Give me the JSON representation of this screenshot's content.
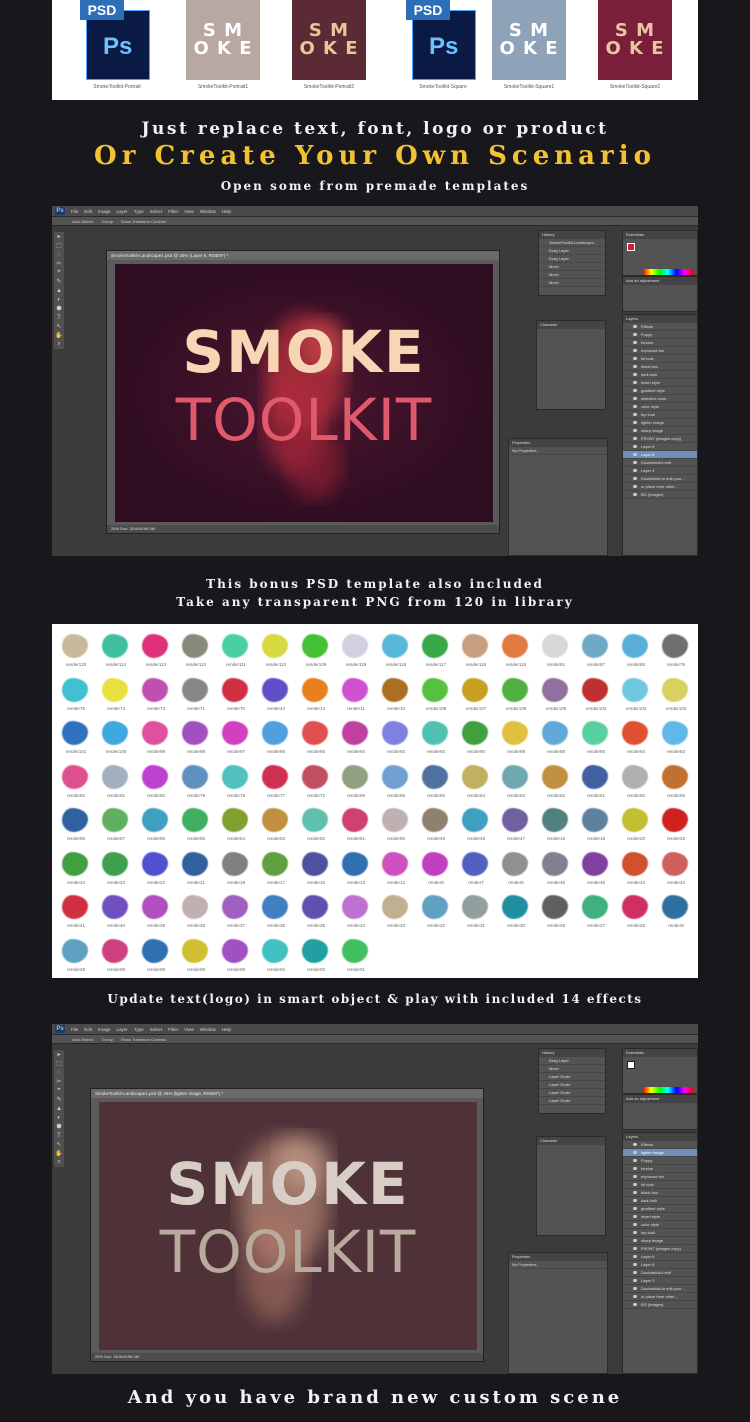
{
  "files": [
    {
      "kind": "psd",
      "ext": "PSD",
      "app": "Ps",
      "caption": "SmokeToolkit-Portrait"
    },
    {
      "kind": "poster",
      "text": "S M O K E",
      "caption": "SmokeToolkit-Portrait1",
      "bg": "#b8a8a4",
      "fg": "#ffffff"
    },
    {
      "kind": "poster",
      "text": "S M O K E",
      "caption": "SmokeToolkit-Portrait2",
      "bg": "#5b2a34",
      "fg": "#e6c79a"
    },
    {
      "kind": "psd",
      "ext": "PSD",
      "app": "Ps",
      "caption": "SmokeToolkit-Square"
    },
    {
      "kind": "poster",
      "text": "S M O K E",
      "caption": "SmokeToolkit-Square1",
      "bg": "#8fa3b8",
      "fg": "#ffffff"
    },
    {
      "kind": "poster",
      "text": "S M O K E",
      "caption": "SmokeToolkit-Square2",
      "bg": "#7a1f3a",
      "fg": "#e8c6a4"
    }
  ],
  "headings": {
    "replace": "Just replace text, font, logo or product",
    "create": "Or Create Your Own Scenario",
    "open": "Open some from premade templates",
    "bonus": "This bonus PSD template also included",
    "take": "Take any transparent PNG from 120 in library",
    "update": "Update text(logo) in smart object & play with included 14 effects",
    "final": "And you have brand new custom scene"
  },
  "ps1": {
    "menu": [
      "File",
      "Edit",
      "Image",
      "Layer",
      "Type",
      "Select",
      "Filter",
      "View",
      "Window",
      "Help"
    ],
    "options": [
      "Auto-Select:",
      "Group",
      "Show Transform Controls"
    ],
    "doc_title": "SmokeToolkit-Landscape1.psd @ 25% (Layer 6, RGB/8*) *",
    "smoke": "SMOKE",
    "toolkit": "TOOLKIT",
    "status": "25%    Doc: 28.6M/196.3M",
    "history_title": "History",
    "history_items": [
      "SmokeToolkit-Landscape...",
      "Drag Layer",
      "Drag Layer",
      "Move",
      "Move",
      "Move"
    ],
    "char_title": "Character",
    "props_title": "Properties",
    "props_text": "No Properties",
    "layers_title": "Layers",
    "layers": [
      "Effects",
      "Poppy",
      "fondue",
      "exposure.fun",
      "bit look",
      "black box",
      "dark look",
      "invert style",
      "gradient style",
      "selective color",
      "color style",
      "top look",
      "lighter image",
      "sharp image",
      "FRONT (images copy)",
      "Layer 8",
      "Layer 8",
      "Doublekick's edit",
      "Layer 3",
      "Doublekick to edit your...",
      "or place here other...",
      "BG (images)"
    ],
    "selected_layer": 16,
    "essentials": "Essentials",
    "adjust_title": "Add an adjustment"
  },
  "ps2": {
    "menu": [
      "File",
      "Edit",
      "Image",
      "Layer",
      "Type",
      "Select",
      "Filter",
      "View",
      "Window",
      "Help"
    ],
    "options": [
      "Auto-Select:",
      "Group",
      "Show Transform Controls"
    ],
    "doc_title": "SmokeToolkit-Landscape1.psd @ 25% (lighter image, RGB/8*) *",
    "smoke": "SMOKE",
    "toolkit": "TOOLKIT",
    "status": "25%    Doc: 28.6M/196.3M",
    "history_title": "History",
    "history_items": [
      "Drag Layer",
      "Move",
      "Layer Order",
      "Layer Order",
      "Layer Order",
      "Layer Order"
    ],
    "char_title": "Character",
    "props_title": "Properties",
    "props_text": "No Properties",
    "layers_title": "Layers",
    "layers": [
      "Effects",
      "lighter image",
      "Poppy",
      "fondue",
      "exposure.fun",
      "bit look",
      "black box",
      "dark look",
      "gradient style",
      "invert style",
      "color style",
      "top look",
      "sharp image",
      "FRONT (images copy)",
      "Layer 8",
      "Layer 8",
      "Doublekick's edit",
      "Layer 3",
      "Doublekick to edit your...",
      "or place here other...",
      "BG (images)"
    ],
    "selected_layer": 1,
    "essentials": "Essentials",
    "adjust_title": "Add an adjustment"
  },
  "library": {
    "cols": 16,
    "labels": [
      "render120",
      "render114",
      "render113",
      "render112",
      "render111",
      "render110",
      "render109",
      "render119",
      "render118",
      "render117",
      "render116",
      "render115",
      "render91",
      "render87",
      "render86",
      "render76",
      "render75",
      "render74",
      "render73",
      "render71",
      "render70",
      "render44",
      "render14",
      "render11",
      "render10",
      "render108",
      "render107",
      "render106",
      "render105",
      "render104",
      "render103",
      "render102",
      "render101",
      "render100",
      "render99",
      "render98",
      "render97",
      "render96",
      "render95",
      "render94",
      "render93",
      "render92",
      "render90",
      "render89",
      "render88",
      "render85",
      "render84",
      "render83",
      "render82",
      "render81",
      "render80",
      "render79",
      "render78",
      "render77",
      "render72",
      "render69",
      "render68",
      "render66",
      "render64",
      "render63",
      "render62",
      "render61",
      "render60",
      "render59",
      "render58",
      "render57",
      "render56",
      "render55",
      "render54",
      "render53",
      "render52",
      "render51",
      "render50",
      "render49",
      "render48",
      "render47",
      "render15",
      "render18",
      "render20",
      "render25",
      "render24",
      "render23",
      "render22",
      "render21",
      "render19",
      "render17",
      "render16",
      "render13",
      "render12",
      "render8",
      "render7",
      "render6",
      "render46",
      "render45",
      "render43",
      "render42",
      "render41",
      "render40",
      "render39",
      "render38",
      "render37",
      "render36",
      "render35",
      "render34",
      "render33",
      "render32",
      "render31",
      "render30",
      "render29",
      "render27",
      "render26",
      "render9",
      "render28",
      "render09",
      "render08",
      "render06",
      "render05",
      "render04",
      "render03",
      "render01"
    ],
    "colors": [
      "#c9b89a",
      "#3fbf9f",
      "#e0307a",
      "#8a8a7a",
      "#4ad0a0",
      "#d8d840",
      "#44c034",
      "#d0d0e0",
      "#58b8d8",
      "#38a848",
      "#c8a080",
      "#e07a40",
      "#d8d8d8",
      "#70a8c8",
      "#58b0d8",
      "#707070",
      "#40c0d0",
      "#e8e040",
      "#c050b0",
      "#888888",
      "#d03040",
      "#6050c8",
      "#e88020",
      "#d050d0",
      "#a87020",
      "#58c040",
      "#c8a020",
      "#50b040",
      "#9070a0",
      "#c03030",
      "#70c8e0",
      "#d8d060",
      "#3070c0",
      "#40a8e0",
      "#e050a0",
      "#a050c0",
      "#d040c0",
      "#50a0e0",
      "#e05050",
      "#c040a0",
      "#8080e0",
      "#50c0b0",
      "#40a040",
      "#e0c040",
      "#60a8d8",
      "#58d0a0",
      "#e05030",
      "#60b8e8",
      "#e05090",
      "#a0b0c0",
      "#c040d0",
      "#6090c0",
      "#50c0c0",
      "#d03050",
      "#c05060",
      "#90a080",
      "#70a0d0",
      "#5070a0",
      "#c0b060",
      "#70a8b0",
      "#c09040",
      "#4060a0",
      "#b0b0b0",
      "#c07030",
      "#3060a0",
      "#60b060",
      "#40a0c0",
      "#40b060",
      "#80a030",
      "#c09040",
      "#60c0b0",
      "#d04070",
      "#c0b0b0",
      "#908070",
      "#40a0c0",
      "#7060a0",
      "#508080",
      "#6080a0",
      "#c0c030",
      "#d02020",
      "#40a040",
      "#40a050",
      "#5050d0",
      "#3060a0",
      "#808080",
      "#60a040",
      "#5050a0",
      "#3070b0",
      "#d050c0",
      "#c040c0",
      "#5060c0",
      "#909090",
      "#808090",
      "#8040a0",
      "#d05030",
      "#d06060",
      "#d03040",
      "#7050c0",
      "#b050c0",
      "#c0b0b0",
      "#a060c0",
      "#4080c0",
      "#6050b0",
      "#c070d0",
      "#c0b090",
      "#60a0c0",
      "#90a0a0",
      "#2090a0",
      "#606060",
      "#40b080",
      "#d03060",
      "#3070a0",
      "#60a0c0",
      "#d04080",
      "#3070b0",
      "#d0c030",
      "#a050c0",
      "#40c0c0",
      "#20a0a0",
      "#40c060"
    ]
  },
  "colors": {
    "background": "#18181c",
    "gold": "#f2c232",
    "ps_panel": "#535353",
    "canvas1": "#3d1128",
    "canvas2": "#4e3238"
  }
}
